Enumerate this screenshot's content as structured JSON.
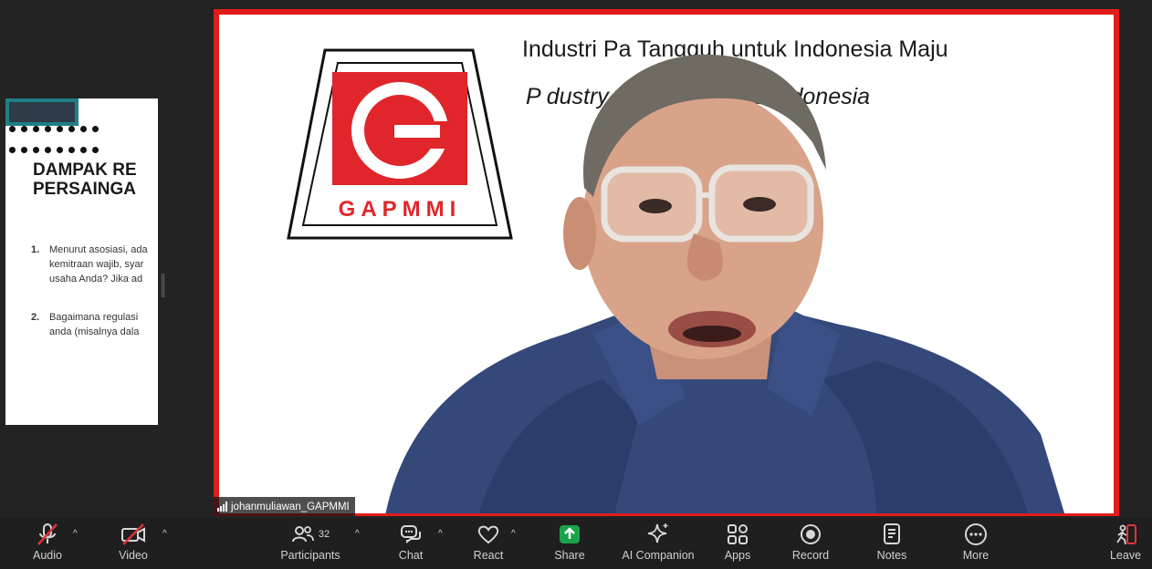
{
  "slide": {
    "heading_line1": "DAMPAK RE",
    "heading_line2": "PERSAINGA",
    "q1_num": "1.",
    "q1_line1": "Menurut asosiasi, ada",
    "q1_line2": "kemitraan wajib, syar",
    "q1_line3": "usaha Anda? Jika ad",
    "q2_num": "2.",
    "q2_line1": "Bagaimana regulasi",
    "q2_line2": "anda (misalnya dala"
  },
  "video": {
    "logo_text": "GAPMMI",
    "logo_letter": "G",
    "banner_line1": "Industri Pa      Tangguh untuk Indonesia Maju",
    "banner_line2": "P                  dustry for Prosperous Indonesia",
    "participant_name": "johanmuliawan_GAPMMI",
    "frame_color": "#e21b1b"
  },
  "toolbar": {
    "audio": "Audio",
    "video": "Video",
    "participants": "Participants",
    "participants_count": "32",
    "chat": "Chat",
    "react": "React",
    "share": "Share",
    "ai_companion": "AI Companion",
    "apps": "Apps",
    "record": "Record",
    "notes": "Notes",
    "more": "More",
    "leave": "Leave",
    "share_color": "#1aa34a",
    "muted_color": "#e0333a"
  }
}
